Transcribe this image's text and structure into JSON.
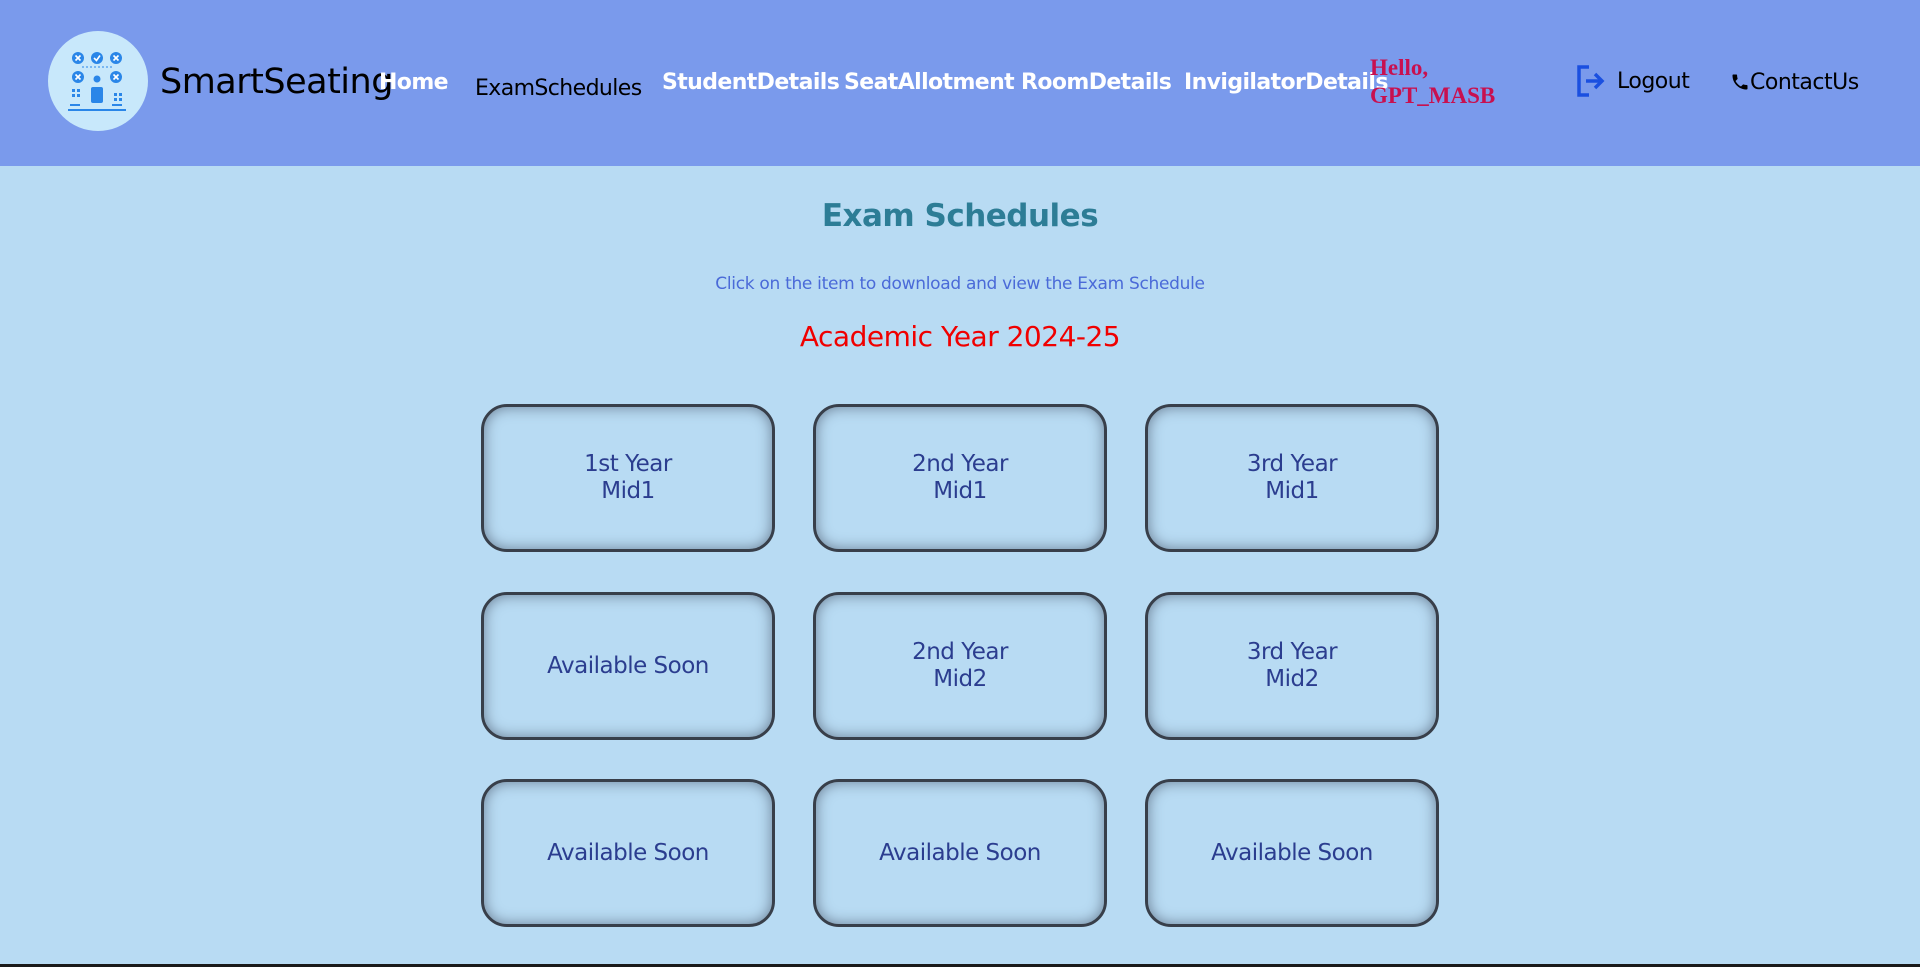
{
  "header": {
    "brand": "SmartSeating",
    "nav": [
      {
        "label": "Home",
        "active": false
      },
      {
        "label": "ExamSchedules",
        "active": true
      },
      {
        "label": "StudentDetails",
        "active": false
      },
      {
        "label": "SeatAllotment",
        "active": false
      },
      {
        "label": "RoomDetails",
        "active": false
      },
      {
        "label": "InvigilatorDetails",
        "active": false
      }
    ],
    "greeting_line1": "Hello,",
    "greeting_line2": "GPT_MASB",
    "logout_label": "Logout",
    "contact_label": "ContactUs",
    "logo_icon": "classroom-seating-icon"
  },
  "main": {
    "title": "Exam Schedules",
    "subtitle": "Click on the item to download and view the Exam Schedule",
    "academic_year": "Academic Year 2024-25",
    "cards": [
      {
        "line1": "1st Year",
        "line2": "Mid1"
      },
      {
        "line1": "2nd Year",
        "line2": "Mid1"
      },
      {
        "line1": "3rd Year",
        "line2": "Mid1"
      },
      {
        "line1": "Available Soon",
        "line2": ""
      },
      {
        "line1": "2nd Year",
        "line2": "Mid2"
      },
      {
        "line1": "3rd Year",
        "line2": "Mid2"
      },
      {
        "line1": "Available Soon",
        "line2": ""
      },
      {
        "line1": "Available Soon",
        "line2": ""
      },
      {
        "line1": "Available Soon",
        "line2": ""
      }
    ]
  },
  "colors": {
    "navbar": "#7a9aec",
    "background": "#b8dbf3",
    "title": "#2d7d96",
    "subtitle": "#4a6ad8",
    "year": "#f00000",
    "greeting": "#c8104f",
    "card_text": "#2b3d8f",
    "logout_icon": "#1a4fe0"
  }
}
